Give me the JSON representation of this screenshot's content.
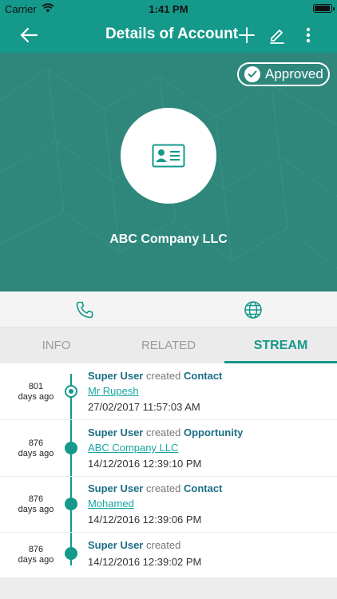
{
  "status_bar": {
    "carrier": "Carrier",
    "time": "1:41 PM",
    "battery_level": 1.0
  },
  "nav": {
    "title": "Details of Account"
  },
  "header": {
    "badge": "Approved",
    "company_name": "ABC Company LLC"
  },
  "colors": {
    "primary": "#14998a",
    "hero": "#2f877c",
    "link": "#18a6a0",
    "user": "#1b6e86"
  },
  "tabs": [
    {
      "label": "INFO",
      "active": false
    },
    {
      "label": "RELATED",
      "active": false
    },
    {
      "label": "STREAM",
      "active": true
    }
  ],
  "stream": [
    {
      "ago_num": "801",
      "ago_unit": "days ago",
      "user": "Super User",
      "verb": "created",
      "type": "Contact",
      "link": "Mr Rupesh",
      "date": "27/02/2017 11:57:03 AM"
    },
    {
      "ago_num": "876",
      "ago_unit": "days ago",
      "user": "Super User",
      "verb": "created",
      "type": "Opportunity",
      "link": "ABC Company LLC",
      "date": "14/12/2016 12:39:10 PM"
    },
    {
      "ago_num": "876",
      "ago_unit": "days ago",
      "user": "Super User",
      "verb": "created",
      "type": "Contact",
      "link": "Mohamed",
      "date": "14/12/2016 12:39:06 PM"
    },
    {
      "ago_num": "876",
      "ago_unit": "days ago",
      "user": "Super User",
      "verb": "created",
      "type": "",
      "link": "",
      "date": "14/12/2016 12:39:02 PM"
    }
  ]
}
